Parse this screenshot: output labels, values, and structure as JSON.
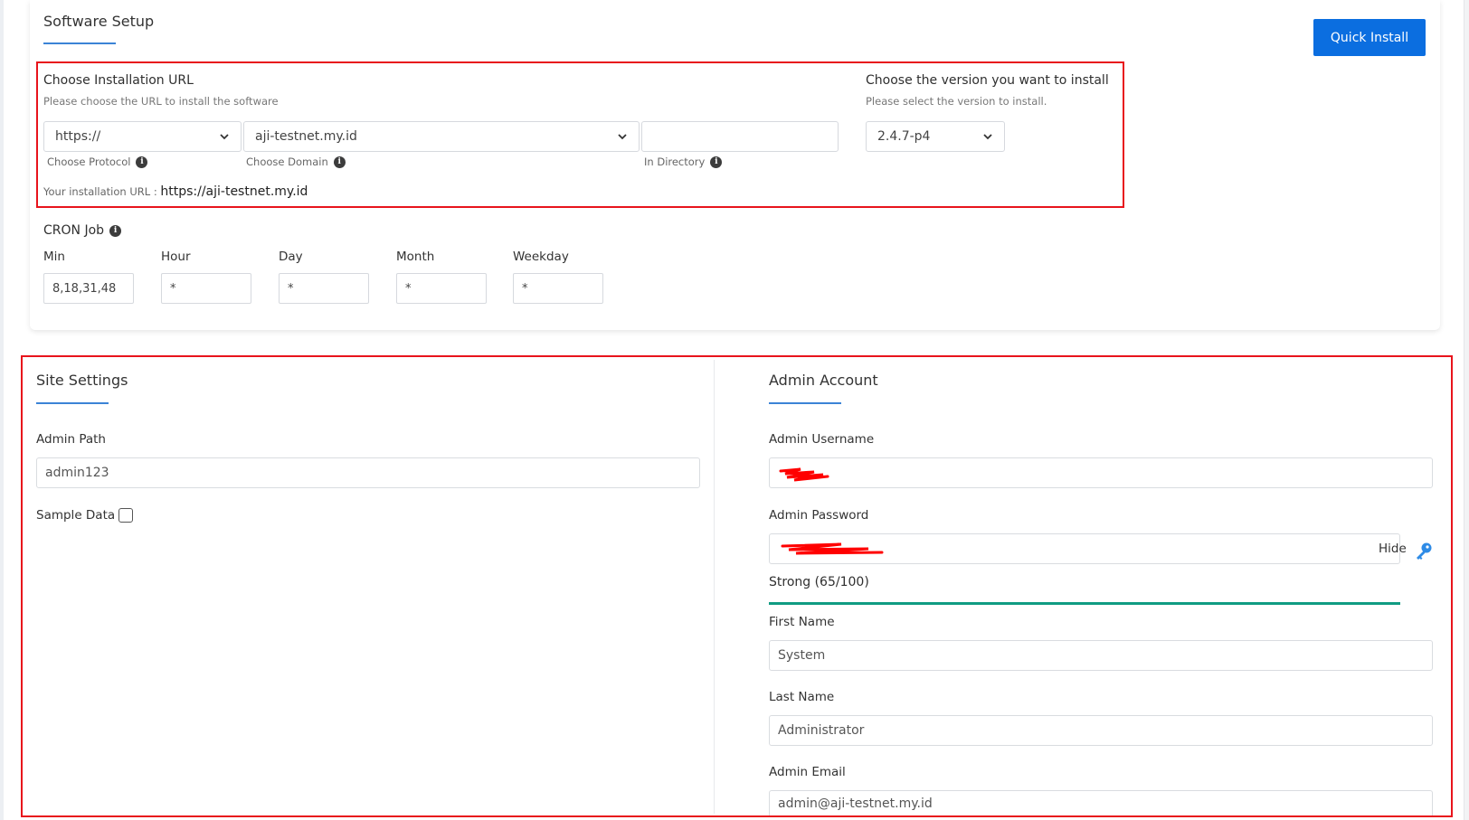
{
  "software_setup": {
    "title": "Software Setup",
    "quick_install_label": "Quick Install"
  },
  "installation_url": {
    "heading": "Choose Installation URL",
    "hint": "Please choose the URL to install the software",
    "protocol_value": "https://",
    "domain_value": "aji-testnet.my.id",
    "directory_value": "",
    "protocol_label": "Choose Protocol",
    "domain_label": "Choose Domain",
    "directory_label": "In Directory",
    "your_url_label": "Your installation URL :",
    "your_url_value": "https://aji-testnet.my.id"
  },
  "version": {
    "heading": "Choose the version you want to install",
    "hint": "Please select the version to install.",
    "value": "2.4.7-p4"
  },
  "cron": {
    "title": "CRON Job",
    "min_label": "Min",
    "hour_label": "Hour",
    "day_label": "Day",
    "month_label": "Month",
    "weekday_label": "Weekday",
    "min_value": "8,18,31,48",
    "hour_value": "*",
    "day_value": "*",
    "month_value": "*",
    "weekday_value": "*"
  },
  "site_settings": {
    "title": "Site Settings",
    "admin_path_label": "Admin Path",
    "admin_path_value": "admin123",
    "sample_data_label": "Sample Data"
  },
  "admin_account": {
    "title": "Admin Account",
    "username_label": "Admin Username",
    "password_label": "Admin Password",
    "hide_label": "Hide",
    "strength_text": "Strong (65/100)",
    "strength_score": 65,
    "first_name_label": "First Name",
    "first_name_value": "System",
    "last_name_label": "Last Name",
    "last_name_value": "Administrator",
    "email_label": "Admin Email",
    "email_value": "admin@aji-testnet.my.id"
  },
  "colors": {
    "accent_blue": "#0b6ee0",
    "highlight_red": "#e8141c",
    "strength_green": "#109c82"
  }
}
